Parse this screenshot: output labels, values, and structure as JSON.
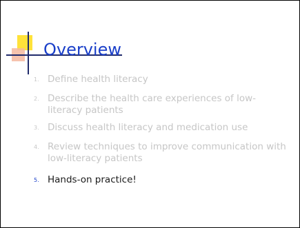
{
  "slide": {
    "title": "Overview",
    "items": [
      {
        "number": "1.",
        "text": "Define health literacy",
        "active": false
      },
      {
        "number": "2.",
        "text": "Describe the health care experiences of low-literacy patients",
        "active": false
      },
      {
        "number": "3.",
        "text": "Discuss health literacy and medication use",
        "active": false
      },
      {
        "number": "4.",
        "text": "Review techniques to improve communication with low-literacy patients",
        "active": false
      },
      {
        "number": "5.",
        "text": "Hands-on practice!",
        "active": true
      }
    ]
  },
  "colors": {
    "title": "#1a3fc9",
    "inactive_text": "#c6c6c6",
    "active_text": "#1a1a1a",
    "accent_yellow": "#ffe23a",
    "accent_red": "#f5b8a0",
    "accent_navy": "#1f2a6b"
  }
}
